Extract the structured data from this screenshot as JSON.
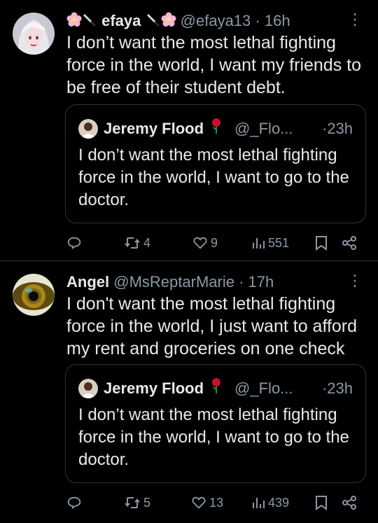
{
  "tweets": [
    {
      "display_name": "efaya",
      "handle": "@efaya13",
      "time": "16h",
      "text": "I don’t want the most lethal fighting force in the world, I want my friends to be free of their student debt.",
      "quote": {
        "display_name": "Jeremy Flood",
        "handle": "@_Flo...",
        "time": "23h",
        "text": "I don’t want the most lethal fighting force in the world, I want to go to the doctor."
      },
      "stats": {
        "replies": "",
        "retweets": "4",
        "likes": "9",
        "views": "551"
      }
    },
    {
      "display_name": "Angel",
      "handle": "@MsReptarMarie",
      "time": "17h",
      "text": "I don't want the most lethal fighting force in the world, I just want to afford my rent and groceries on one check",
      "quote": {
        "display_name": "Jeremy Flood",
        "handle": "@_Flo...",
        "time": "23h",
        "text": "I don’t want the most lethal fighting force in the world, I want to go to the doctor."
      },
      "stats": {
        "replies": "",
        "retweets": "5",
        "likes": "13",
        "views": "439"
      }
    }
  ],
  "separator": "·",
  "more_glyph": "⋮",
  "colors": {
    "background": "#000000",
    "text": "#e7e9ea",
    "secondary": "#8b98a5",
    "border": "#2f3336",
    "rose": "#c8102e",
    "flower": "#f7b6d2"
  },
  "icons": [
    "flower-emoji",
    "knife-emoji",
    "rose-emoji",
    "reply-icon",
    "retweet-icon",
    "like-icon",
    "views-icon",
    "bookmark-icon",
    "share-icon"
  ]
}
